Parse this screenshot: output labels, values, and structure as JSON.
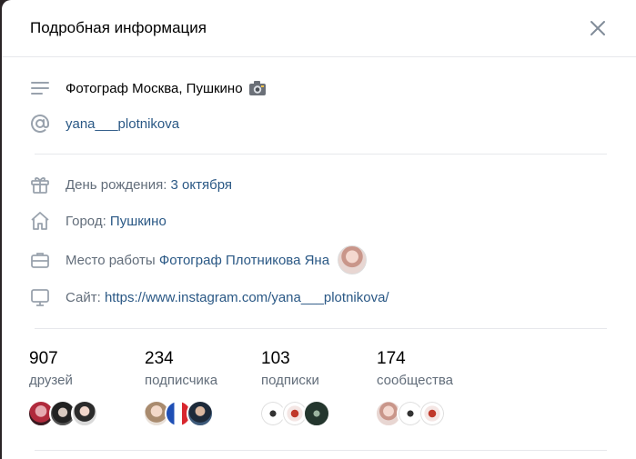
{
  "header": {
    "title": "Подробная информация"
  },
  "info": {
    "status": "Фотограф Москва, Пушкино",
    "username": "yana___plotnikova"
  },
  "details": {
    "birthday_label": "День рождения:",
    "birthday_value": "3 октября",
    "city_label": "Город:",
    "city_value": "Пушкино",
    "work_label": "Место работы",
    "work_value": "Фотограф Плотникова Яна",
    "site_label": "Сайт:",
    "site_value": "https://www.instagram.com/yana___plotnikova/"
  },
  "stats": [
    {
      "count": "907",
      "label": "друзей"
    },
    {
      "count": "234",
      "label": "подписчика"
    },
    {
      "count": "103",
      "label": "подписки"
    },
    {
      "count": "174",
      "label": "сообщества"
    }
  ],
  "colors": {
    "link": "#2a5885",
    "secondary": "#626d7a",
    "icon": "#99a2ad",
    "divider": "#e7e8ec"
  }
}
